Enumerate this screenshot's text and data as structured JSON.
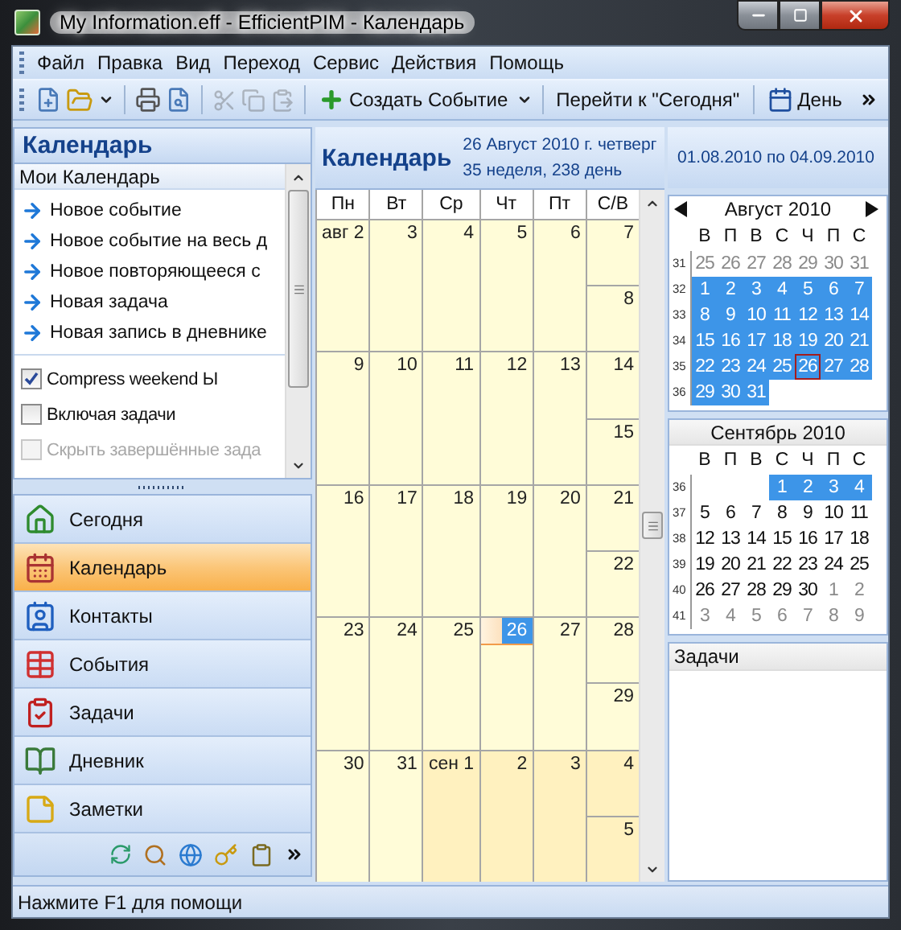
{
  "window": {
    "title": "My Information.eff - EfficientPIM - Календарь"
  },
  "menu": [
    "Файл",
    "Правка",
    "Вид",
    "Переход",
    "Сервис",
    "Действия",
    "Помощь"
  ],
  "toolbar": {
    "create_event": "Создать Событие",
    "go_today": "Перейти к \"Сегодня\"",
    "day_view": "День"
  },
  "sidebar": {
    "title": "Календарь",
    "section": "Мои Календарь",
    "actions": [
      "Новое событие",
      "Новое событие на весь д",
      "Новое повторяющееся с",
      "Новая задача",
      "Новая запись в дневнике"
    ],
    "options": [
      {
        "label": "Compress weekend Ы",
        "checked": true,
        "disabled": false
      },
      {
        "label": "Включая задачи",
        "checked": false,
        "disabled": false
      },
      {
        "label": "Скрыть завершённые зада",
        "checked": false,
        "disabled": true
      }
    ],
    "nav": [
      {
        "label": "Сегодня",
        "selected": false
      },
      {
        "label": "Календарь",
        "selected": true
      },
      {
        "label": "Контакты",
        "selected": false
      },
      {
        "label": "События",
        "selected": false
      },
      {
        "label": "Задачи",
        "selected": false
      },
      {
        "label": "Дневник",
        "selected": false
      },
      {
        "label": "Заметки",
        "selected": false
      }
    ]
  },
  "calendar": {
    "title": "Календарь",
    "date_line": "26 Август 2010 г. четверг",
    "week_line": "35 неделя, 238 день",
    "range": "01.08.2010 по 04.09.2010",
    "columns": [
      "Пн",
      "Вт",
      "Ср",
      "Чт",
      "Пт",
      "С/В"
    ],
    "weeks": [
      {
        "days": [
          {
            "label": "авг 2",
            "in_month": true,
            "selected": false
          },
          {
            "label": "3",
            "in_month": true,
            "selected": false
          },
          {
            "label": "4",
            "in_month": true,
            "selected": false
          },
          {
            "label": "5",
            "in_month": true,
            "selected": false
          },
          {
            "label": "6",
            "in_month": true,
            "selected": false
          },
          {
            "label": "7",
            "in_month": true,
            "selected": false
          },
          {
            "label": "8",
            "in_month": true,
            "selected": false
          }
        ]
      },
      {
        "days": [
          {
            "label": "9",
            "in_month": true,
            "selected": false
          },
          {
            "label": "10",
            "in_month": true,
            "selected": false
          },
          {
            "label": "11",
            "in_month": true,
            "selected": false
          },
          {
            "label": "12",
            "in_month": true,
            "selected": false
          },
          {
            "label": "13",
            "in_month": true,
            "selected": false
          },
          {
            "label": "14",
            "in_month": true,
            "selected": false
          },
          {
            "label": "15",
            "in_month": true,
            "selected": false
          }
        ]
      },
      {
        "days": [
          {
            "label": "16",
            "in_month": true,
            "selected": false
          },
          {
            "label": "17",
            "in_month": true,
            "selected": false
          },
          {
            "label": "18",
            "in_month": true,
            "selected": false
          },
          {
            "label": "19",
            "in_month": true,
            "selected": false
          },
          {
            "label": "20",
            "in_month": true,
            "selected": false
          },
          {
            "label": "21",
            "in_month": true,
            "selected": false
          },
          {
            "label": "22",
            "in_month": true,
            "selected": false
          }
        ]
      },
      {
        "days": [
          {
            "label": "23",
            "in_month": true,
            "selected": false
          },
          {
            "label": "24",
            "in_month": true,
            "selected": false
          },
          {
            "label": "25",
            "in_month": true,
            "selected": false
          },
          {
            "label": "26",
            "in_month": true,
            "selected": true
          },
          {
            "label": "27",
            "in_month": true,
            "selected": false
          },
          {
            "label": "28",
            "in_month": true,
            "selected": false
          },
          {
            "label": "29",
            "in_month": true,
            "selected": false
          }
        ]
      },
      {
        "days": [
          {
            "label": "30",
            "in_month": true,
            "selected": false
          },
          {
            "label": "31",
            "in_month": true,
            "selected": false
          },
          {
            "label": "сен 1",
            "in_month": false,
            "selected": false
          },
          {
            "label": "2",
            "in_month": false,
            "selected": false
          },
          {
            "label": "3",
            "in_month": false,
            "selected": false
          },
          {
            "label": "4",
            "in_month": false,
            "selected": false
          },
          {
            "label": "5",
            "in_month": false,
            "selected": false
          }
        ]
      }
    ]
  },
  "mini_calendars": [
    {
      "title": "Август 2010",
      "navigation": true,
      "weekdays": [
        "В",
        "П",
        "В",
        "С",
        "Ч",
        "П",
        "С"
      ],
      "weeks": [
        {
          "number": "31",
          "days": [
            {
              "label": "25",
              "in_month": false,
              "selected": false,
              "today": false
            },
            {
              "label": "26",
              "in_month": false,
              "selected": false,
              "today": false
            },
            {
              "label": "27",
              "in_month": false,
              "selected": false,
              "today": false
            },
            {
              "label": "28",
              "in_month": false,
              "selected": false,
              "today": false
            },
            {
              "label": "29",
              "in_month": false,
              "selected": false,
              "today": false
            },
            {
              "label": "30",
              "in_month": false,
              "selected": false,
              "today": false
            },
            {
              "label": "31",
              "in_month": false,
              "selected": false,
              "today": false
            }
          ]
        },
        {
          "number": "32",
          "days": [
            {
              "label": "1",
              "in_month": true,
              "selected": true,
              "today": false
            },
            {
              "label": "2",
              "in_month": true,
              "selected": true,
              "today": false
            },
            {
              "label": "3",
              "in_month": true,
              "selected": true,
              "today": false
            },
            {
              "label": "4",
              "in_month": true,
              "selected": true,
              "today": false
            },
            {
              "label": "5",
              "in_month": true,
              "selected": true,
              "today": false
            },
            {
              "label": "6",
              "in_month": true,
              "selected": true,
              "today": false
            },
            {
              "label": "7",
              "in_month": true,
              "selected": true,
              "today": false
            }
          ]
        },
        {
          "number": "33",
          "days": [
            {
              "label": "8",
              "in_month": true,
              "selected": true,
              "today": false
            },
            {
              "label": "9",
              "in_month": true,
              "selected": true,
              "today": false
            },
            {
              "label": "10",
              "in_month": true,
              "selected": true,
              "today": false
            },
            {
              "label": "11",
              "in_month": true,
              "selected": true,
              "today": false
            },
            {
              "label": "12",
              "in_month": true,
              "selected": true,
              "today": false
            },
            {
              "label": "13",
              "in_month": true,
              "selected": true,
              "today": false
            },
            {
              "label": "14",
              "in_month": true,
              "selected": true,
              "today": false
            }
          ]
        },
        {
          "number": "34",
          "days": [
            {
              "label": "15",
              "in_month": true,
              "selected": true,
              "today": false
            },
            {
              "label": "16",
              "in_month": true,
              "selected": true,
              "today": false
            },
            {
              "label": "17",
              "in_month": true,
              "selected": true,
              "today": false
            },
            {
              "label": "18",
              "in_month": true,
              "selected": true,
              "today": false
            },
            {
              "label": "19",
              "in_month": true,
              "selected": true,
              "today": false
            },
            {
              "label": "20",
              "in_month": true,
              "selected": true,
              "today": false
            },
            {
              "label": "21",
              "in_month": true,
              "selected": true,
              "today": false
            }
          ]
        },
        {
          "number": "35",
          "days": [
            {
              "label": "22",
              "in_month": true,
              "selected": true,
              "today": false
            },
            {
              "label": "23",
              "in_month": true,
              "selected": true,
              "today": false
            },
            {
              "label": "24",
              "in_month": true,
              "selected": true,
              "today": false
            },
            {
              "label": "25",
              "in_month": true,
              "selected": true,
              "today": false
            },
            {
              "label": "26",
              "in_month": true,
              "selected": true,
              "today": true
            },
            {
              "label": "27",
              "in_month": true,
              "selected": true,
              "today": false
            },
            {
              "label": "28",
              "in_month": true,
              "selected": true,
              "today": false
            }
          ]
        },
        {
          "number": "36",
          "days": [
            {
              "label": "29",
              "in_month": true,
              "selected": true,
              "today": false
            },
            {
              "label": "30",
              "in_month": true,
              "selected": true,
              "today": false
            },
            {
              "label": "31",
              "in_month": true,
              "selected": true,
              "today": false
            }
          ]
        }
      ]
    },
    {
      "title": "Сентябрь 2010",
      "navigation": false,
      "weekdays": [
        "В",
        "П",
        "В",
        "С",
        "Ч",
        "П",
        "С"
      ],
      "weeks": [
        {
          "number": "36",
          "days": [
            {
              "label": "1",
              "in_month": true,
              "selected": true,
              "today": false
            },
            {
              "label": "2",
              "in_month": true,
              "selected": true,
              "today": false
            },
            {
              "label": "3",
              "in_month": true,
              "selected": true,
              "today": false
            },
            {
              "label": "4",
              "in_month": true,
              "selected": true,
              "today": false
            }
          ]
        },
        {
          "number": "37",
          "days": [
            {
              "label": "5",
              "in_month": true,
              "selected": false,
              "today": false
            },
            {
              "label": "6",
              "in_month": true,
              "selected": false,
              "today": false
            },
            {
              "label": "7",
              "in_month": true,
              "selected": false,
              "today": false
            },
            {
              "label": "8",
              "in_month": true,
              "selected": false,
              "today": false
            },
            {
              "label": "9",
              "in_month": true,
              "selected": false,
              "today": false
            },
            {
              "label": "10",
              "in_month": true,
              "selected": false,
              "today": false
            },
            {
              "label": "11",
              "in_month": true,
              "selected": false,
              "today": false
            }
          ]
        },
        {
          "number": "38",
          "days": [
            {
              "label": "12",
              "in_month": true,
              "selected": false,
              "today": false
            },
            {
              "label": "13",
              "in_month": true,
              "selected": false,
              "today": false
            },
            {
              "label": "14",
              "in_month": true,
              "selected": false,
              "today": false
            },
            {
              "label": "15",
              "in_month": true,
              "selected": false,
              "today": false
            },
            {
              "label": "16",
              "in_month": true,
              "selected": false,
              "today": false
            },
            {
              "label": "17",
              "in_month": true,
              "selected": false,
              "today": false
            },
            {
              "label": "18",
              "in_month": true,
              "selected": false,
              "today": false
            }
          ]
        },
        {
          "number": "39",
          "days": [
            {
              "label": "19",
              "in_month": true,
              "selected": false,
              "today": false
            },
            {
              "label": "20",
              "in_month": true,
              "selected": false,
              "today": false
            },
            {
              "label": "21",
              "in_month": true,
              "selected": false,
              "today": false
            },
            {
              "label": "22",
              "in_month": true,
              "selected": false,
              "today": false
            },
            {
              "label": "23",
              "in_month": true,
              "selected": false,
              "today": false
            },
            {
              "label": "24",
              "in_month": true,
              "selected": false,
              "today": false
            },
            {
              "label": "25",
              "in_month": true,
              "selected": false,
              "today": false
            }
          ]
        },
        {
          "number": "40",
          "days": [
            {
              "label": "26",
              "in_month": true,
              "selected": false,
              "today": false
            },
            {
              "label": "27",
              "in_month": true,
              "selected": false,
              "today": false
            },
            {
              "label": "28",
              "in_month": true,
              "selected": false,
              "today": false
            },
            {
              "label": "29",
              "in_month": true,
              "selected": false,
              "today": false
            },
            {
              "label": "30",
              "in_month": true,
              "selected": false,
              "today": false
            },
            {
              "label": "1",
              "in_month": false,
              "selected": false,
              "today": false
            },
            {
              "label": "2",
              "in_month": false,
              "selected": false,
              "today": false
            }
          ]
        },
        {
          "number": "41",
          "days": [
            {
              "label": "3",
              "in_month": false,
              "selected": false,
              "today": false
            },
            {
              "label": "4",
              "in_month": false,
              "selected": false,
              "today": false
            },
            {
              "label": "5",
              "in_month": false,
              "selected": false,
              "today": false
            },
            {
              "label": "6",
              "in_month": false,
              "selected": false,
              "today": false
            },
            {
              "label": "7",
              "in_month": false,
              "selected": false,
              "today": false
            },
            {
              "label": "8",
              "in_month": false,
              "selected": false,
              "today": false
            },
            {
              "label": "9",
              "in_month": false,
              "selected": false,
              "today": false
            }
          ]
        }
      ]
    }
  ],
  "tasks": {
    "title": "Задачи"
  },
  "status_bar": "Нажмите F1 для помощи"
}
